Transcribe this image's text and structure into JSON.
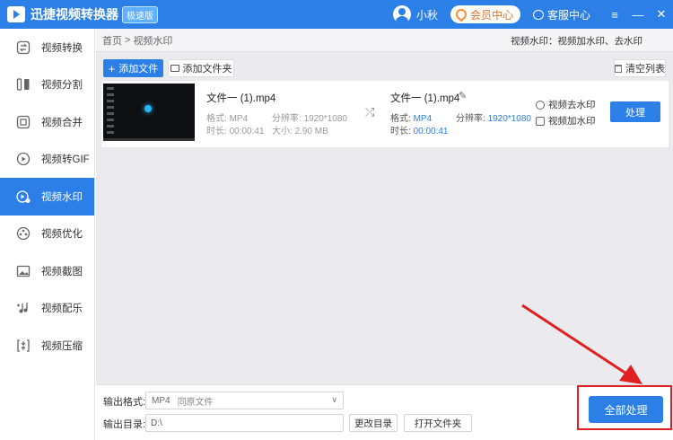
{
  "app": {
    "title": "迅捷视频转换器",
    "badge": "极速版"
  },
  "header": {
    "username": "小秋",
    "member_label": "会员中心",
    "service_label": "客服中心"
  },
  "window_controls": {
    "menu": "≡",
    "minimize": "—",
    "close": "✕"
  },
  "sidebar": {
    "items": [
      {
        "label": "视频转换",
        "icon": "convert-icon"
      },
      {
        "label": "视频分割",
        "icon": "split-icon"
      },
      {
        "label": "视频合并",
        "icon": "merge-icon"
      },
      {
        "label": "视频转GIF",
        "icon": "gif-icon"
      },
      {
        "label": "视频水印",
        "icon": "watermark-icon",
        "active": true
      },
      {
        "label": "视频优化",
        "icon": "optimize-icon"
      },
      {
        "label": "视频截图",
        "icon": "screenshot-icon"
      },
      {
        "label": "视频配乐",
        "icon": "music-icon"
      },
      {
        "label": "视频压缩",
        "icon": "compress-icon"
      }
    ]
  },
  "breadcrumb": {
    "home": "首页",
    "sep": ">",
    "current": "视频水印",
    "right_text": "视频水印：视频加水印、去水印"
  },
  "toolbar": {
    "add_file": "添加文件",
    "add_folder": "添加文件夹",
    "clear_list": "清空列表"
  },
  "file": {
    "source": {
      "name": "文件一 (1).mp4",
      "format_label": "格式:",
      "format": "MP4",
      "resolution_label": "分辨率:",
      "resolution": "1920*1080",
      "duration_label": "时长:",
      "duration": "00:00:41",
      "size_label": "大小:",
      "size": "2.90 MB"
    },
    "output": {
      "name": "文件一 (1).mp4",
      "format_label": "格式:",
      "format": "MP4",
      "resolution_label": "分辨率:",
      "resolution": "1920*1080",
      "duration_label": "时长:",
      "duration": "00:00:41"
    },
    "remove_watermark": "视频去水印",
    "add_watermark": "视频加水印",
    "process": "处理"
  },
  "bottom": {
    "format_label": "输出格式:",
    "format_value": "MP4",
    "format_quality": "同原文件",
    "dir_label": "输出目录:",
    "dir_value": "D:\\",
    "change_dir": "更改目录",
    "open_folder": "打开文件夹",
    "process_all": "全部处理"
  },
  "colors": {
    "accent": "#2b7fe6",
    "highlight": "#e02020"
  }
}
